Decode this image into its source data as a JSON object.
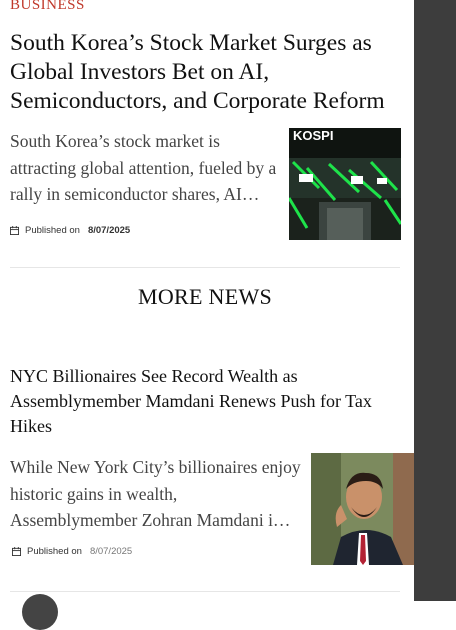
{
  "article1": {
    "category": "BUSINESS",
    "title": "South Korea’s Stock Market Surges as Global Investors Bet on AI, Semiconductors, and Corporate Reform",
    "excerpt": "South Korea’s stock market is attracting global attention, fueled by a rally in semiconductor shares, AI…",
    "published_label": "Published on",
    "date": "8/07/2025",
    "image_text": "KOSPI",
    "image_icon": "stock-board-photo"
  },
  "more_news": {
    "title": "MORE NEWS"
  },
  "article2": {
    "title": "NYC Billionaires See Record Wealth as Assemblymember Mamdani Renews Push for Tax Hikes",
    "excerpt": "While New York City’s billionaires enjoy historic gains in wealth, Assemblymember Zohran Mamdani i…",
    "published_label": "Published on",
    "date": "8/07/2025",
    "image_icon": "person-photo"
  },
  "colors": {
    "category": "#c0392b",
    "scrollbar": "#3d3d3d",
    "divider": "#e6e6e6"
  }
}
